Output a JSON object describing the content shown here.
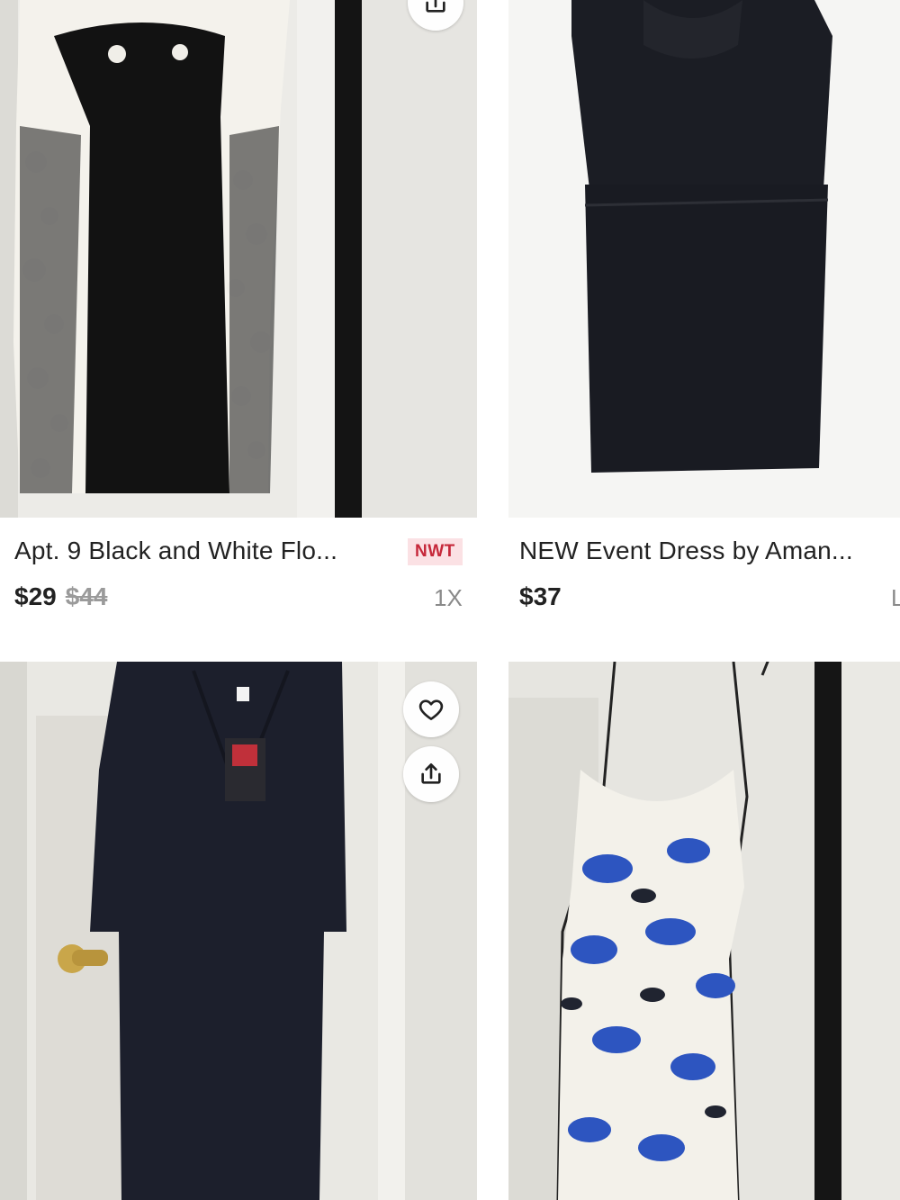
{
  "listings": [
    {
      "title": "Apt. 9 Black and White Flo...",
      "badge": "NWT",
      "price": "$29",
      "original_price": "$44",
      "size": "1X",
      "actions": {
        "share_icon": "share-icon"
      }
    },
    {
      "title": "NEW Event Dress by Aman...",
      "price": "$37",
      "size": "L"
    },
    {
      "actions": {
        "like_icon": "heart-icon",
        "share_icon": "share-icon"
      }
    },
    {}
  ],
  "colors": {
    "badge_bg": "#fbe1e4",
    "badge_text": "#c6283a",
    "price_text": "#222222",
    "strikethrough_text": "#9a9a9a",
    "muted_text": "#8a8a8a"
  }
}
